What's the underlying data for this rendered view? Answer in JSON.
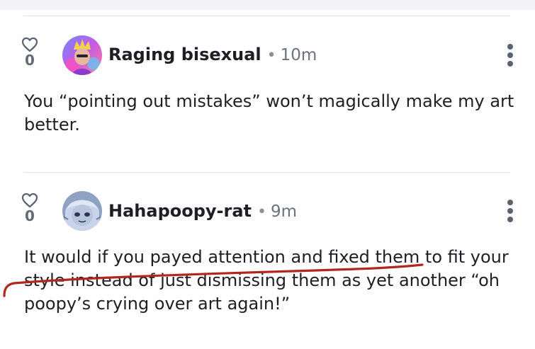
{
  "comments": [
    {
      "votes": "0",
      "username": "Raging bisexual",
      "separator": "•",
      "time": "10m",
      "text": "You “pointing out mistakes” won’t magically make my art better."
    },
    {
      "votes": "0",
      "username": "Hahapoopy-rat",
      "separator": "•",
      "time": "9m",
      "text": "It would if you payed attention and fixed them to fit your style instead of just dismissing them as yet another “oh poopy’s crying over art again!”"
    }
  ],
  "icons": {
    "like": "heart-outline-icon",
    "menu": "vertical-ellipsis-icon"
  },
  "colors": {
    "annotation": "#b3261e",
    "icon": "#5a6170",
    "text": "#1e1f24"
  }
}
